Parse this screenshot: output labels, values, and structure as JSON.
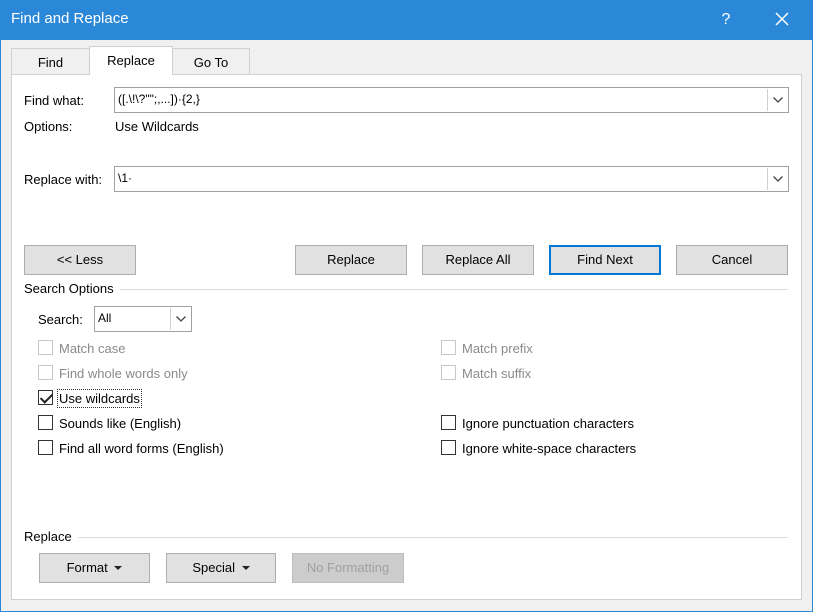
{
  "window": {
    "title": "Find and Replace",
    "help_label": "?"
  },
  "tabs": [
    {
      "label": "Find",
      "active": false
    },
    {
      "label": "Replace",
      "active": true
    },
    {
      "label": "Go To",
      "active": false
    }
  ],
  "find": {
    "label": "Find what:",
    "value": "([.\\!\\?\"\";,...])·{2,}",
    "options_label": "Options:",
    "options_value": "Use Wildcards"
  },
  "replace": {
    "label": "Replace with:",
    "value": "\\1·"
  },
  "buttons": {
    "less": "<< Less",
    "replace": "Replace",
    "replace_all": "Replace All",
    "find_next": "Find Next",
    "cancel": "Cancel"
  },
  "search_options": {
    "heading": "Search Options",
    "search_label": "Search:",
    "search_value": "All",
    "left_checks": [
      {
        "label": "Match case",
        "checked": false,
        "enabled": false
      },
      {
        "label": "Find whole words only",
        "checked": false,
        "enabled": false
      },
      {
        "label": "Use wildcards",
        "checked": true,
        "enabled": true
      },
      {
        "label": "Sounds like (English)",
        "checked": false,
        "enabled": true
      },
      {
        "label": "Find all word forms (English)",
        "checked": false,
        "enabled": true
      }
    ],
    "right_checks": [
      {
        "label": "Match prefix",
        "checked": false,
        "enabled": false
      },
      {
        "label": "Match suffix",
        "checked": false,
        "enabled": false
      },
      {
        "label": "Ignore punctuation characters",
        "checked": false,
        "enabled": true
      },
      {
        "label": "Ignore white-space characters",
        "checked": false,
        "enabled": true
      }
    ]
  },
  "replace_section": {
    "heading": "Replace",
    "format": "Format",
    "special": "Special",
    "no_formatting": "No Formatting"
  },
  "colors": {
    "titlebar": "#2b88d8",
    "dialog_bg": "#f0f0f0",
    "default_button_border": "#0078d7"
  }
}
